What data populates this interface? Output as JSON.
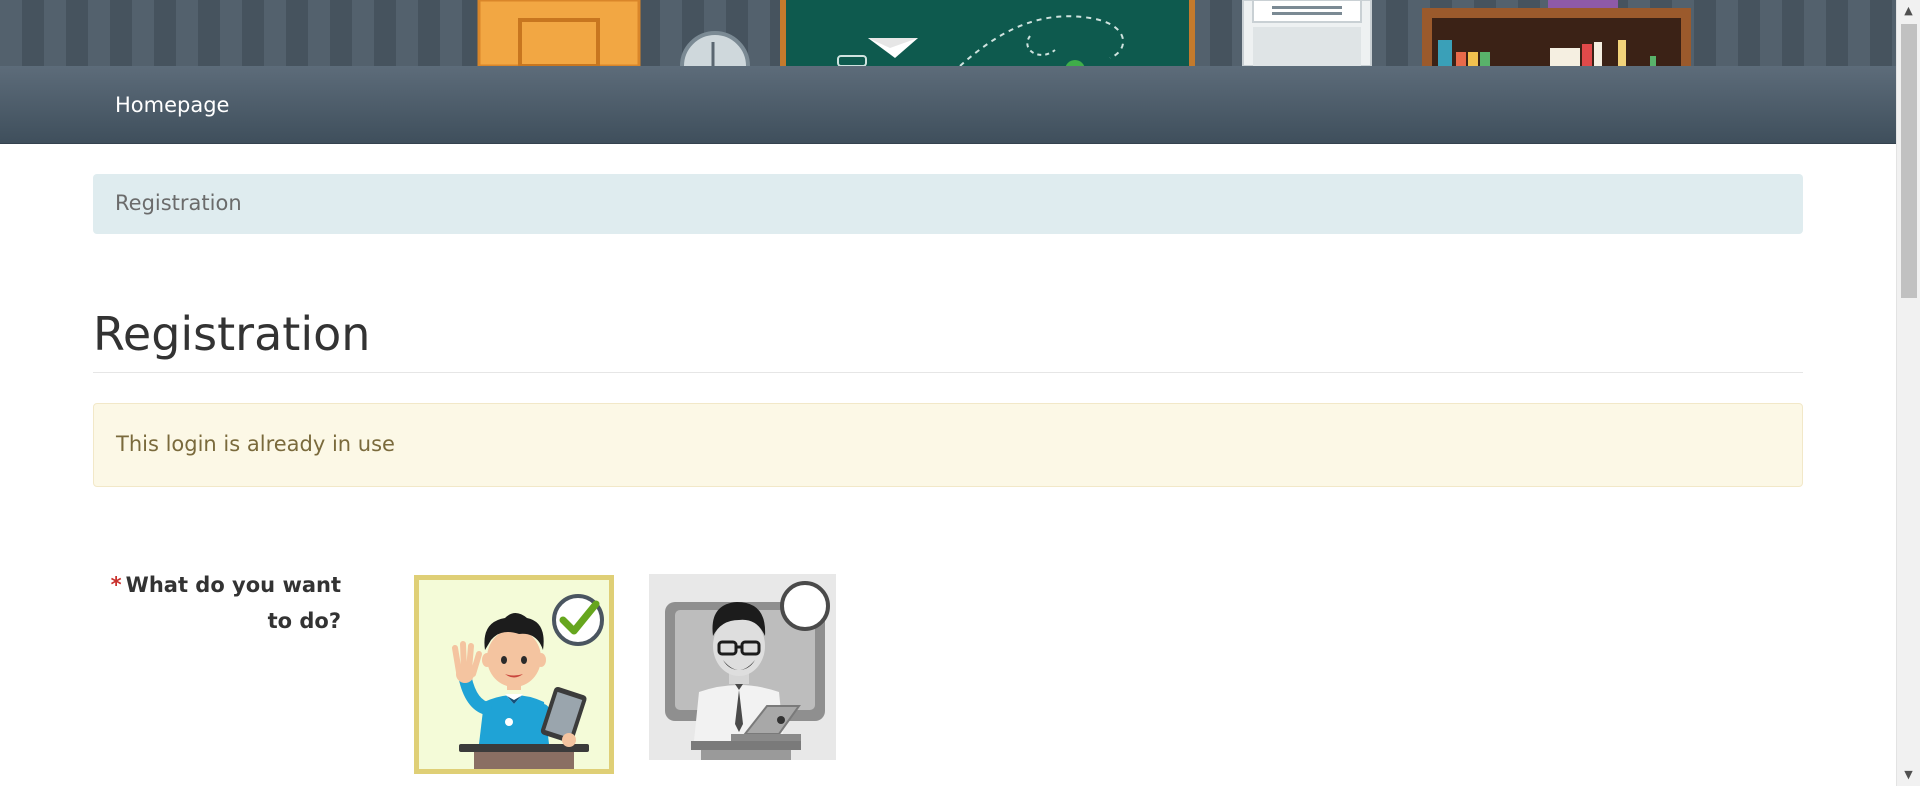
{
  "navbar": {
    "home_label": "Homepage"
  },
  "breadcrumb": {
    "current": "Registration"
  },
  "page": {
    "title": "Registration"
  },
  "alert": {
    "message": "This login is already in use"
  },
  "form": {
    "question": {
      "required_marker": "*",
      "label": "What do you want to do?"
    },
    "choices": [
      {
        "role": "learner",
        "icon": "student-with-tablet-illustration",
        "selected": true
      },
      {
        "role": "teacher",
        "icon": "teacher-with-laptop-illustration",
        "selected": false
      }
    ]
  },
  "colors": {
    "navbar": "#4a5966",
    "breadcrumb_bg": "#dfecef",
    "alert_bg": "#fcf8e6",
    "alert_text": "#7a6a3c",
    "required": "#c9302c",
    "selected_border": "#dfcf76",
    "check_green": "#66a61e"
  }
}
